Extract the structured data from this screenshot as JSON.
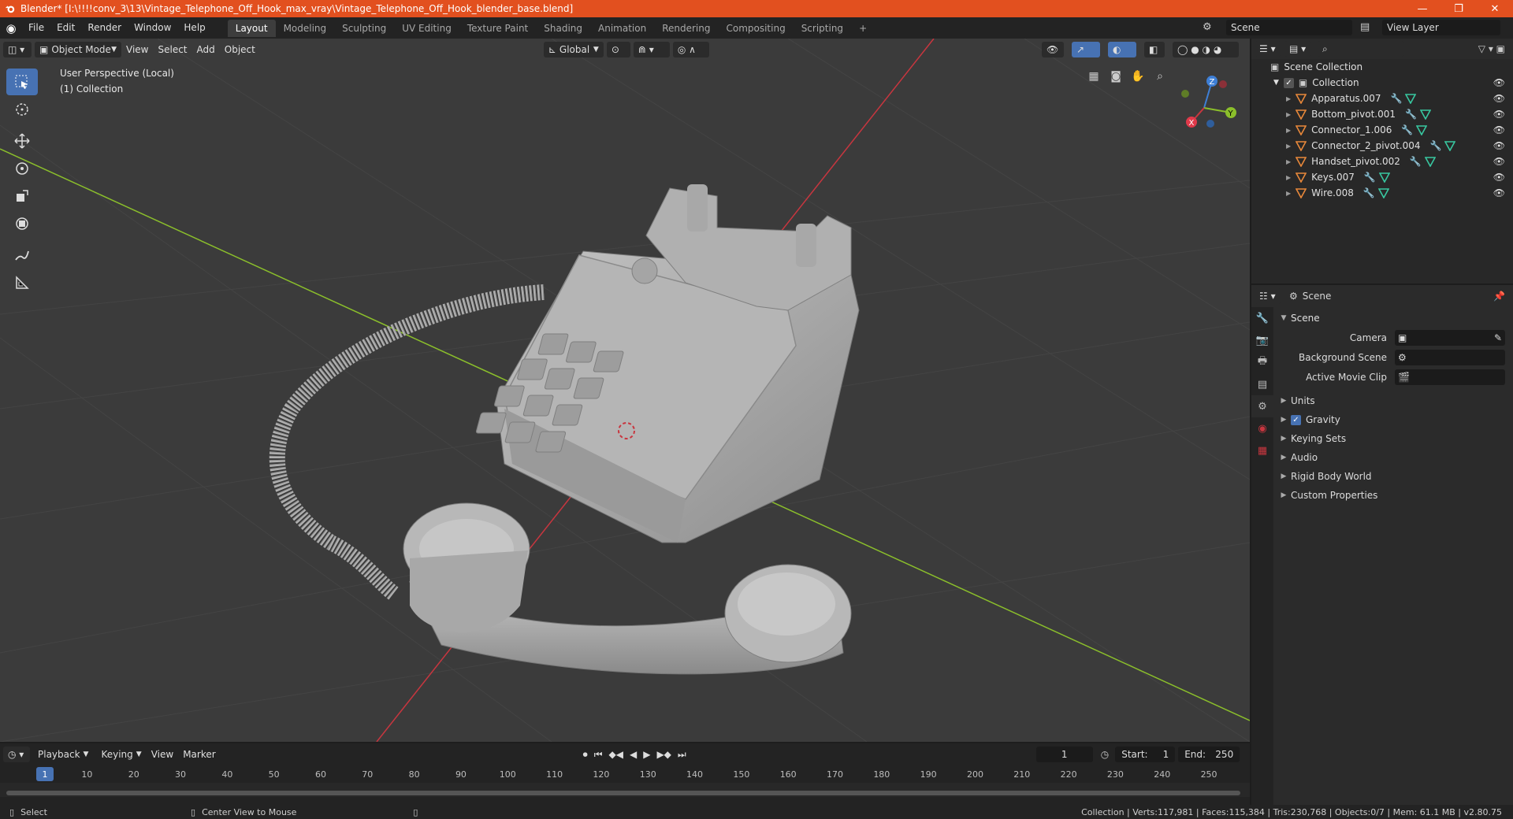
{
  "window": {
    "title": "Blender* [I:\\!!!!conv_3\\13\\Vintage_Telephone_Off_Hook_max_vray\\Vintage_Telephone_Off_Hook_blender_base.blend]",
    "minimize": "—",
    "maximize": "❐",
    "close": "✕"
  },
  "menu": {
    "items": [
      "File",
      "Edit",
      "Render",
      "Window",
      "Help"
    ]
  },
  "workspaces": {
    "tabs": [
      "Layout",
      "Modeling",
      "Sculpting",
      "UV Editing",
      "Texture Paint",
      "Shading",
      "Animation",
      "Rendering",
      "Compositing",
      "Scripting"
    ],
    "add": "+"
  },
  "scene_selector": {
    "value": "Scene"
  },
  "view_layer": {
    "value": "View Layer"
  },
  "viewport": {
    "mode": "Object Mode",
    "menus": [
      "View",
      "Select",
      "Add",
      "Object"
    ],
    "orientation": "Global",
    "info_line1": "User Perspective (Local)",
    "info_line2": "(1) Collection",
    "gizmo": {
      "x": "X",
      "y": "Y",
      "z": "Z"
    }
  },
  "timeline": {
    "menus": [
      "Playback",
      "Keying",
      "View",
      "Marker"
    ],
    "current_frame": "1",
    "start_label": "Start:",
    "start_value": "1",
    "end_label": "End:",
    "end_value": "250",
    "ticks": [
      "1",
      "10",
      "20",
      "30",
      "40",
      "50",
      "60",
      "70",
      "80",
      "90",
      "100",
      "110",
      "120",
      "130",
      "140",
      "150",
      "160",
      "170",
      "180",
      "190",
      "200",
      "210",
      "220",
      "230",
      "240",
      "250"
    ]
  },
  "outliner": {
    "root": "Scene Collection",
    "collection": "Collection",
    "objects": [
      "Apparatus.007",
      "Bottom_pivot.001",
      "Connector_1.006",
      "Connector_2_pivot.004",
      "Handset_pivot.002",
      "Keys.007",
      "Wire.008"
    ]
  },
  "properties": {
    "header": "Scene",
    "panel": "Scene",
    "camera_label": "Camera",
    "background_label": "Background Scene",
    "clip_label": "Active Movie Clip",
    "subpanels": [
      "Units",
      "Gravity",
      "Keying Sets",
      "Audio",
      "Rigid Body World",
      "Custom Properties"
    ]
  },
  "statusbar": {
    "select": "Select",
    "center": "Center View to Mouse",
    "stats": "Collection | Verts:117,981 | Faces:115,384 | Tris:230,768 | Objects:0/7 | Mem: 61.1 MB | v2.80.75"
  },
  "colors": {
    "titlebar": "#e2501f",
    "accent": "#4772b3",
    "x_axis": "#c8363f",
    "y_axis": "#8bbf2b",
    "mesh_icon": "#e8883a",
    "modifier_icon": "#5a9fe0",
    "data_icon": "#38c7a0"
  }
}
